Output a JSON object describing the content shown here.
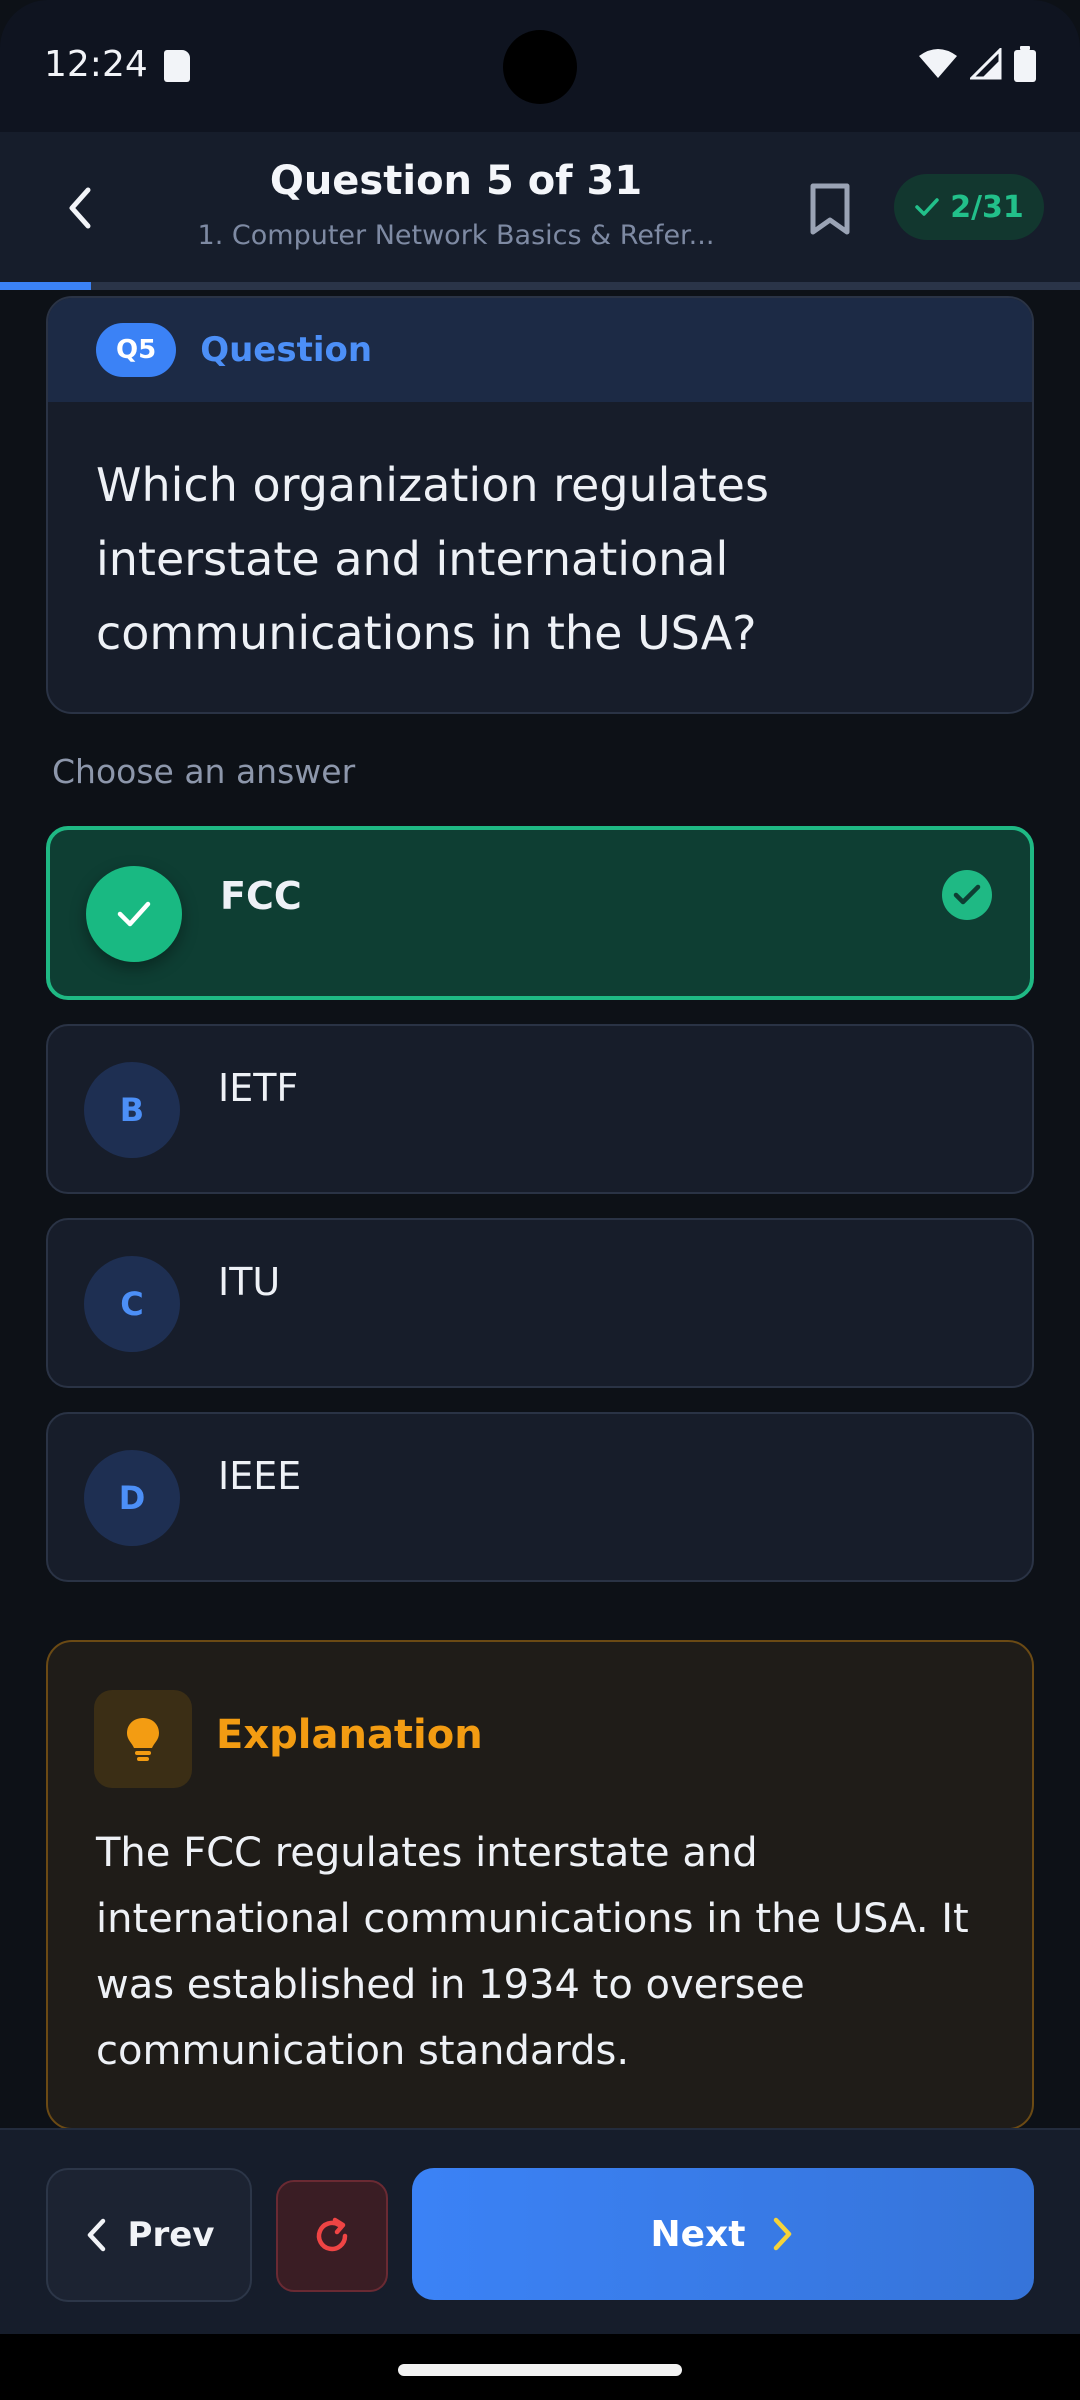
{
  "status_bar": {
    "time": "12:24",
    "icons": [
      "sd-card-icon",
      "wifi-icon",
      "signal-icon",
      "battery-icon"
    ]
  },
  "header": {
    "title": "Question 5 of 31",
    "subtitle": "1. Computer Network Basics & Refer...",
    "score": "2/31",
    "progress_fraction": 0.084
  },
  "question": {
    "badge": "Q5",
    "label": "Question",
    "text": "Which organization regulates interstate and international communications in the USA?"
  },
  "answers": {
    "prompt": "Choose an answer",
    "options": [
      {
        "letter": "A",
        "text": "FCC",
        "state": "correct"
      },
      {
        "letter": "B",
        "text": "IETF",
        "state": "default"
      },
      {
        "letter": "C",
        "text": "ITU",
        "state": "default"
      },
      {
        "letter": "D",
        "text": "IEEE",
        "state": "default"
      }
    ]
  },
  "explanation": {
    "title": "Explanation",
    "text": "The FCC regulates interstate and international communications in the USA. It was established in 1934 to oversee communication standards."
  },
  "footer": {
    "prev_label": "Prev",
    "next_label": "Next"
  },
  "colors": {
    "accent": "#3b82f6",
    "correct": "#1fb984",
    "explanation": "#f39c12",
    "reset": "#ef4444"
  }
}
